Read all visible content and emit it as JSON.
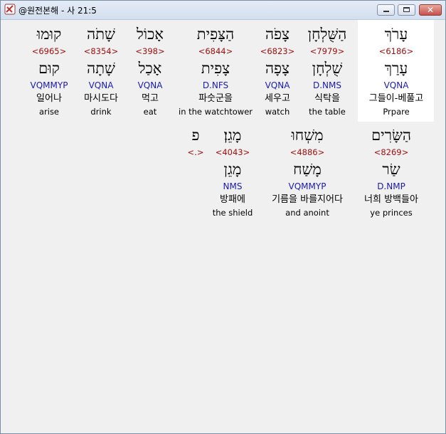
{
  "window": {
    "title": "@원전본해 - 사 21:5",
    "close_glyph": "✕"
  },
  "colors": {
    "strong": "#a01010",
    "morph": "#1a1ab0",
    "highlight_bg": "#ffffff"
  },
  "row1": [
    {
      "hebrew": "עָרֹךְ",
      "strong": "<6186>",
      "lemma": "עָרַךְ",
      "morph": "VQNA",
      "korean": "그들이-베풀고",
      "english": "Prpare"
    },
    {
      "hebrew": "הַשֻּׁלְחָן",
      "strong": "<7979>",
      "lemma": "שֻׁלְחָן",
      "morph": "D.NMS",
      "korean": "식탁을",
      "english": "the table"
    },
    {
      "hebrew": "צָפֹה",
      "strong": "<6823>",
      "lemma": "צָפָה",
      "morph": "VQNA",
      "korean": "세우고",
      "english": "watch"
    },
    {
      "hebrew": "הַצָּפִית",
      "strong": "<6844>",
      "lemma": "צָפִית",
      "morph": "D.NFS",
      "korean": "파숫군을",
      "english": "in the watchtower"
    },
    {
      "hebrew": "אָכוֹל",
      "strong": "<398>",
      "lemma": "אָכַל",
      "morph": "VQNA",
      "korean": "먹고",
      "english": "eat"
    },
    {
      "hebrew": "שָׁתֹה",
      "strong": "<8354>",
      "lemma": "שָׁתָה",
      "morph": "VQNA",
      "korean": "마시도다",
      "english": "drink"
    },
    {
      "hebrew": "קוּמוּ",
      "strong": "<6965>",
      "lemma": "קוּם",
      "morph": "VQMMYP",
      "korean": "일어나",
      "english": "arise"
    }
  ],
  "row2": [
    {
      "hebrew": "הַשָּׂרִים",
      "strong": "<8269>",
      "lemma": "שַׂר",
      "morph": "D.NMP",
      "korean": "너희 방백들아",
      "english": "ye princes"
    },
    {
      "hebrew": "מִשְׁחוּ",
      "strong": "<4886>",
      "lemma": "מָשַׁח",
      "morph": "VQMMYP",
      "korean": "기름을 바를지어다",
      "english": "and anoint"
    },
    {
      "hebrew": "מָגֵן׃",
      "strong": "<4043>",
      "lemma": "מָגֵן",
      "morph": "NMS",
      "korean": "방패에",
      "english": "the shield"
    },
    {
      "hebrew": "פ",
      "strong": "<.>",
      "lemma": "",
      "morph": "",
      "korean": "",
      "english": ""
    }
  ]
}
